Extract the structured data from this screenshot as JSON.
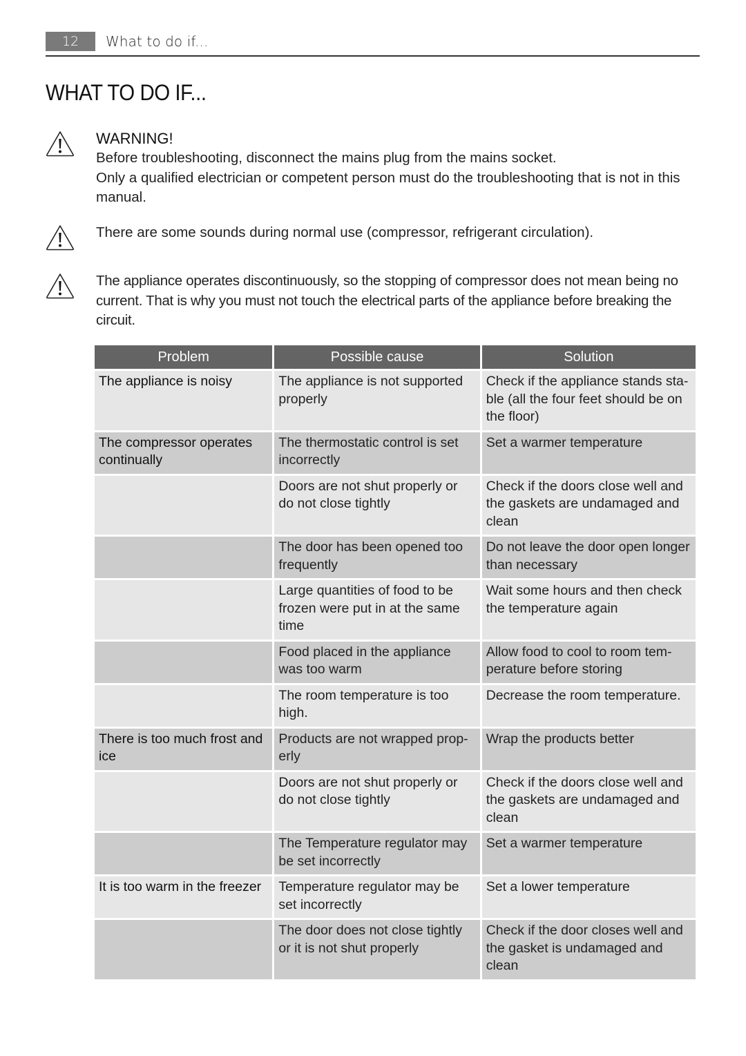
{
  "header": {
    "page_number": "12",
    "running_title": "What to do if..."
  },
  "page_title": "WHAT TO DO IF...",
  "warnings": [
    {
      "icon": "warning-triangle-icon",
      "heading": "WARNING!",
      "lines": [
        "Before troubleshooting, disconnect the mains plug from the mains socket.",
        "Only a qualified electrician or competent person must do the troubleshooting that is not in this manual."
      ]
    },
    {
      "icon": "warning-triangle-icon",
      "lines": [
        "There are some sounds during normal use (compressor, refrigerant circulation)."
      ]
    },
    {
      "icon": "warning-triangle-icon",
      "lines": [
        "The appliance operates discontinuously, so the stopping of compressor does not mean be­ing no current. That is why you must not touch the electrical parts of the appliance before breaking the circuit."
      ]
    }
  ],
  "table": {
    "columns": [
      "Problem",
      "Possible cause",
      "Solution"
    ],
    "rows": [
      {
        "problem": "The appliance is noisy",
        "cause": "The appliance is not supported properly",
        "solution": "Check if the appliance stands sta­ble (all the four feet should be on the floor)",
        "shade": "light"
      },
      {
        "problem": "The compressor operates continually",
        "cause": "The thermostatic control is set incorrectly",
        "solution": "Set a warmer temperature",
        "shade": "dark"
      },
      {
        "problem": "",
        "cause": "Doors are not shut properly or do not close tightly",
        "solution": "Check if the doors close well and the gaskets are undamaged and clean",
        "shade": "light"
      },
      {
        "problem": "",
        "cause": "The door has been opened too frequently",
        "solution": "Do not leave the door open lon­ger than necessary",
        "shade": "dark"
      },
      {
        "problem": "",
        "cause": "Large quantities of food to be frozen were put in at the same time",
        "solution": "Wait some hours and then check the temperature again",
        "shade": "light"
      },
      {
        "problem": "",
        "cause": "Food placed in the appliance was too warm",
        "solution": "Allow food to cool to room tem­perature before storing",
        "shade": "dark"
      },
      {
        "problem": "",
        "cause": "The room temperature is too high.",
        "solution": "Decrease the room temperature.",
        "shade": "light"
      },
      {
        "problem": "There is too much frost and ice",
        "cause": "Products are not wrapped prop­erly",
        "solution": "Wrap the products better",
        "shade": "dark"
      },
      {
        "problem": "",
        "cause": "Doors are not shut properly or do not close tightly",
        "solution": "Check if the doors close well and the gaskets are undamaged and clean",
        "shade": "light"
      },
      {
        "problem": "",
        "cause": "The Temperature regulator may be set incorrectly",
        "solution": "Set a warmer temperature",
        "shade": "dark"
      },
      {
        "problem": "It is too warm in the freezer",
        "cause": "Temperature regulator may be set incorrectly",
        "solution": "Set a lower temperature",
        "shade": "light"
      },
      {
        "problem": "",
        "cause": "The door does not close tightly or it is not shut properly",
        "solution": "Check if the door closes well and the gasket is undamaged and clean",
        "shade": "dark"
      }
    ]
  },
  "colors": {
    "header_fill": "#646464",
    "row_light": "#e6e6e6",
    "row_dark": "#cccccc",
    "page_number_fill": "#7a7a7a"
  }
}
